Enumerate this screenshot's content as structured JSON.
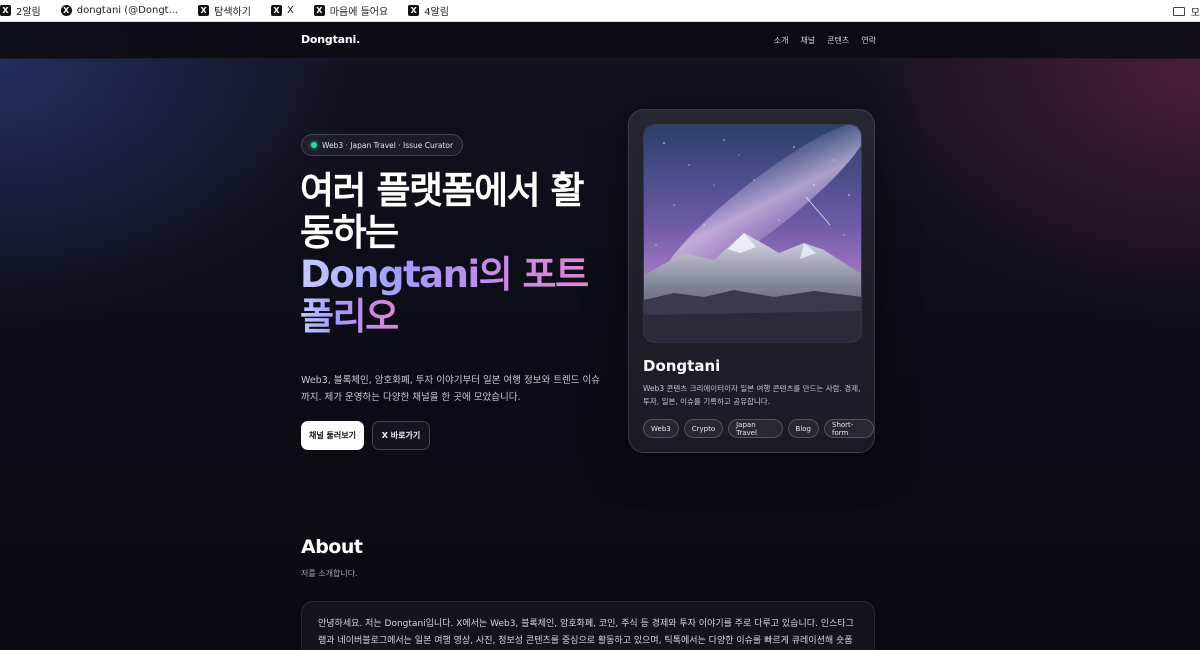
{
  "bookmarks": [
    {
      "label": "2알림",
      "icon": "x-logo-icon"
    },
    {
      "label": "dongtani (@Dongt...",
      "icon": "x-logo-icon"
    },
    {
      "label": "탐색하기",
      "icon": "x-logo-icon"
    },
    {
      "label": "X",
      "icon": "x-logo-icon"
    },
    {
      "label": "마음에 들어요",
      "icon": "x-logo-icon"
    },
    {
      "label": "4알림",
      "icon": "x-logo-icon"
    }
  ],
  "bookmarks_folder": {
    "label": "모",
    "icon": "folder-icon"
  },
  "nav": {
    "logo": "Dongtani.",
    "links": [
      "소개",
      "채널",
      "콘텐츠",
      "연락"
    ]
  },
  "hero": {
    "pill": "Web3 · Japan Travel · Issue Curator",
    "headline_line1": "여러 플랫폼에서 활",
    "headline_line2": "동하는",
    "headline_highlight_1": "Dongtani의 포트",
    "headline_highlight_2": "폴리오",
    "description": "Web3, 블록체인, 암호화폐, 투자 이야기부터 일본 여행 정보와 트렌드 이슈까지. 제가 운영하는 다양한 채널을 한 곳에 모았습니다.",
    "primary_button": "채널 둘러보기",
    "secondary_button": "X 바로가기"
  },
  "profile": {
    "name": "Dongtani",
    "bio": "Web3 콘텐츠 크리에이터이자 일본 여행 콘텐츠를 만드는 사람. 경제, 투자, 일본, 이슈를 기록하고 공유합니다.",
    "tags": [
      "Web3",
      "Crypto",
      "Japan Travel",
      "Blog",
      "Short-form"
    ]
  },
  "about": {
    "title": "About",
    "subtitle": "저를 소개합니다.",
    "body": "안녕하세요. 저는 Dongtani입니다. X에서는 Web3, 블록체인, 암호화폐, 코인, 주식 등 경제와 투자 이야기를 주로 다루고 있습니다. 인스타그램과 네이버블로그에서는 일본 여행 영상, 사진, 정보성 콘텐츠를 중심으로 활동하고 있으며, 틱톡에서는 다양한 이슈를 빠르게 큐레이션해 숏폼 콘텐츠로 전달"
  },
  "colors": {
    "accent_green": "#34d399",
    "gradient_start": "#c7c9ff",
    "gradient_end": "#d98ad0"
  }
}
